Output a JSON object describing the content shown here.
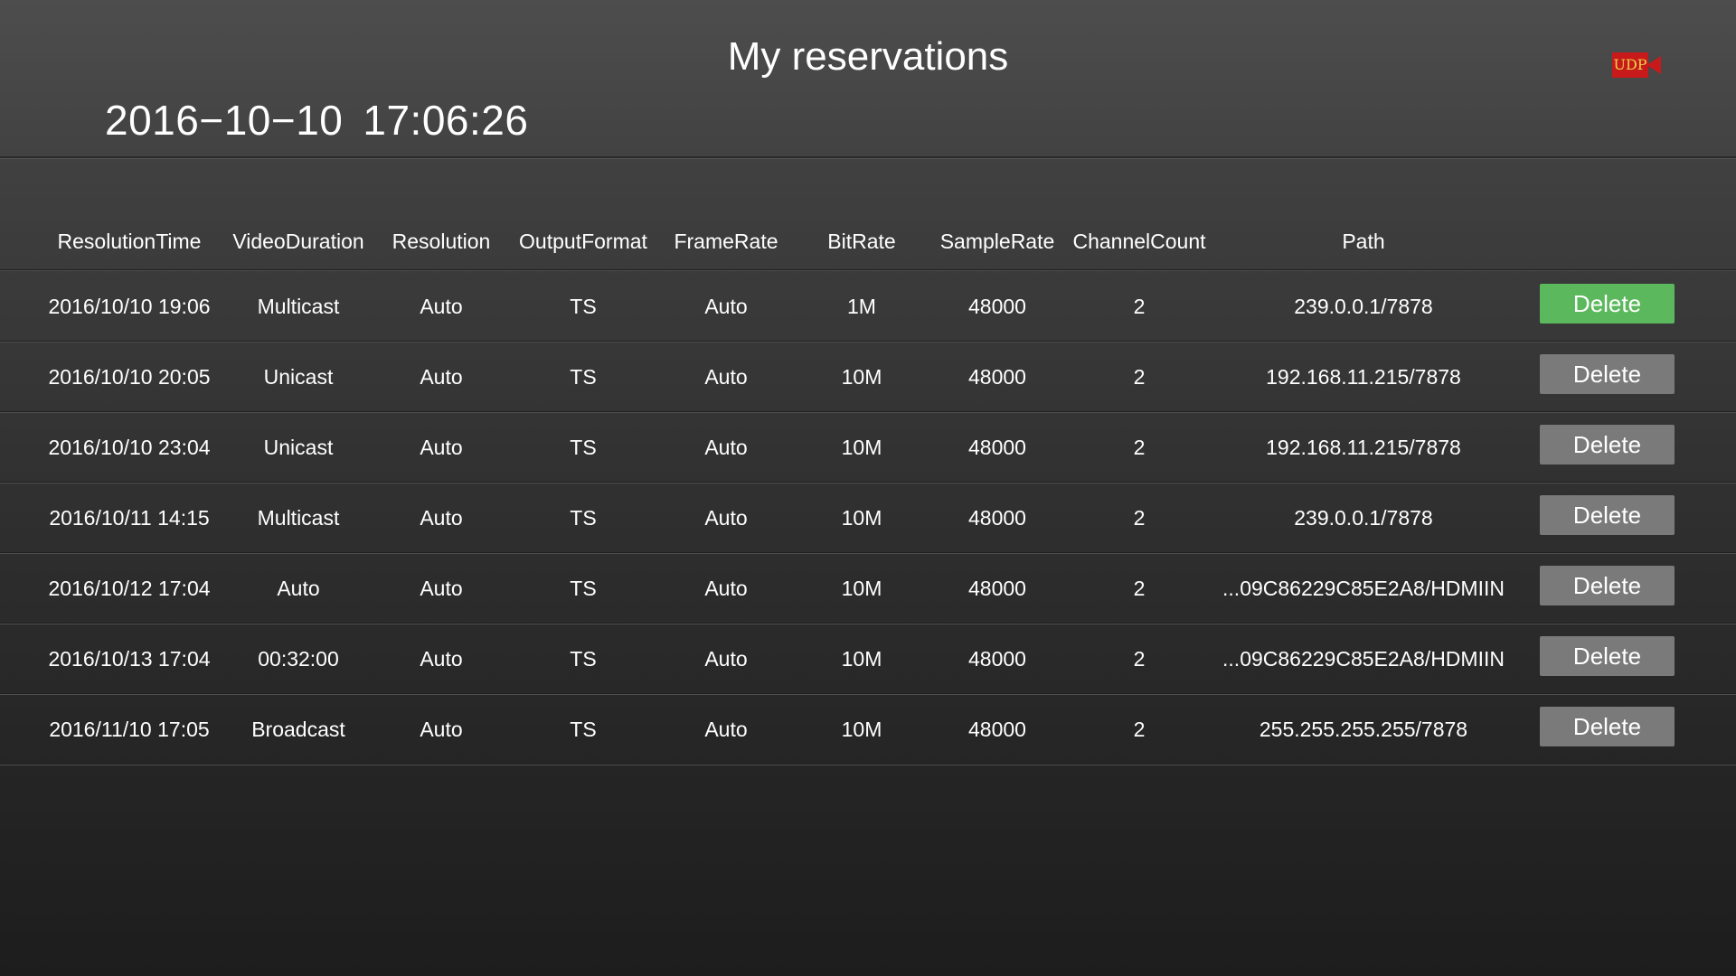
{
  "header": {
    "title": "My reservations",
    "date": "2016−10−10",
    "time": "17:06:26",
    "badge_text": "UDP",
    "badge_color": "#c81a1a"
  },
  "table": {
    "columns": [
      "ResolutionTime",
      "VideoDuration",
      "Resolution",
      "OutputFormat",
      "FrameRate",
      "BitRate",
      "SampleRate",
      "ChannelCount",
      "Path"
    ],
    "rows": [
      {
        "time": "2016/10/10 19:06",
        "duration": "Multicast",
        "resolution": "Auto",
        "format": "TS",
        "framerate": "Auto",
        "bitrate": "1M",
        "samplerate": "48000",
        "channels": "2",
        "path": "239.0.0.1/7878",
        "action": "Delete",
        "focused": true
      },
      {
        "time": "2016/10/10 20:05",
        "duration": "Unicast",
        "resolution": "Auto",
        "format": "TS",
        "framerate": "Auto",
        "bitrate": "10M",
        "samplerate": "48000",
        "channels": "2",
        "path": "192.168.11.215/7878",
        "action": "Delete",
        "focused": false
      },
      {
        "time": "2016/10/10 23:04",
        "duration": "Unicast",
        "resolution": "Auto",
        "format": "TS",
        "framerate": "Auto",
        "bitrate": "10M",
        "samplerate": "48000",
        "channels": "2",
        "path": "192.168.11.215/7878",
        "action": "Delete",
        "focused": false
      },
      {
        "time": "2016/10/11 14:15",
        "duration": "Multicast",
        "resolution": "Auto",
        "format": "TS",
        "framerate": "Auto",
        "bitrate": "10M",
        "samplerate": "48000",
        "channels": "2",
        "path": "239.0.0.1/7878",
        "action": "Delete",
        "focused": false
      },
      {
        "time": "2016/10/12 17:04",
        "duration": "Auto",
        "resolution": "Auto",
        "format": "TS",
        "framerate": "Auto",
        "bitrate": "10M",
        "samplerate": "48000",
        "channels": "2",
        "path": "...09C86229C85E2A8/HDMIIN",
        "action": "Delete",
        "focused": false
      },
      {
        "time": "2016/10/13 17:04",
        "duration": "00:32:00",
        "resolution": "Auto",
        "format": "TS",
        "framerate": "Auto",
        "bitrate": "10M",
        "samplerate": "48000",
        "channels": "2",
        "path": "...09C86229C85E2A8/HDMIIN",
        "action": "Delete",
        "focused": false
      },
      {
        "time": "2016/11/10 17:05",
        "duration": "Broadcast",
        "resolution": "Auto",
        "format": "TS",
        "framerate": "Auto",
        "bitrate": "10M",
        "samplerate": "48000",
        "channels": "2",
        "path": "255.255.255.255/7878",
        "action": "Delete",
        "focused": false
      }
    ]
  },
  "colors": {
    "active_button": "#5cb85c",
    "inactive_button": "#7a7a7a"
  }
}
